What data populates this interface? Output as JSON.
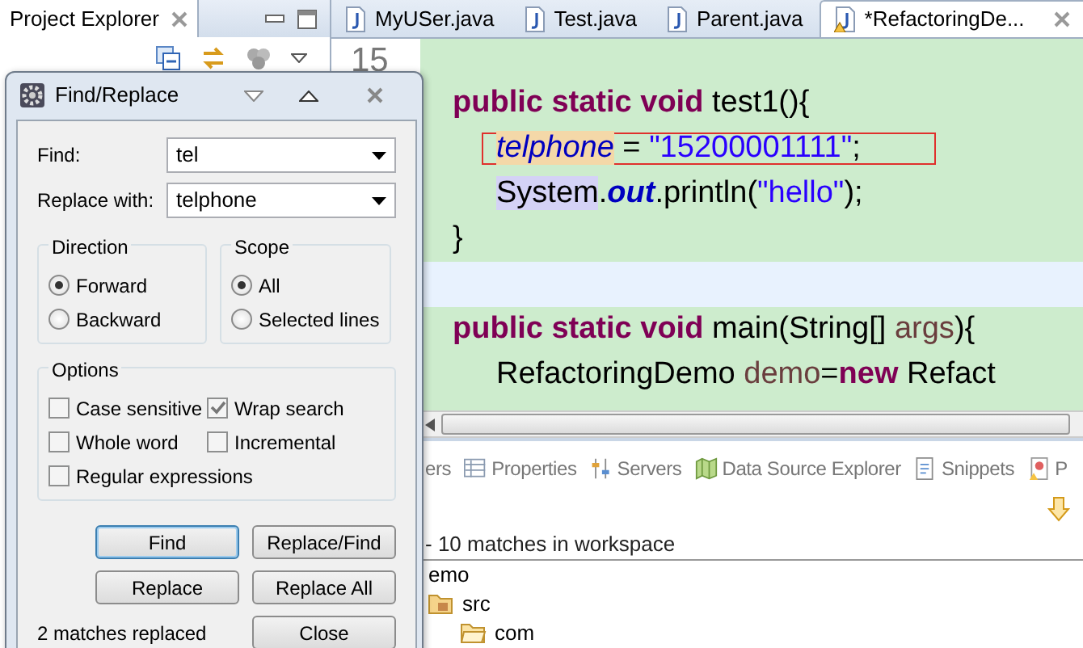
{
  "project_explorer": {
    "tab": "Project Explorer"
  },
  "editor_tabs": [
    {
      "label": "MyUSer.java",
      "selected": false,
      "warning": false
    },
    {
      "label": "Test.java",
      "selected": false,
      "warning": false
    },
    {
      "label": "Parent.java",
      "selected": false,
      "warning": false
    },
    {
      "label": "*RefactoringDe...",
      "selected": true,
      "warning": true
    }
  ],
  "editor": {
    "line_number": "15",
    "lines": [
      {
        "indented": false,
        "boxed": false,
        "current": false,
        "tokens": [
          {
            "text": "public static void",
            "kind": "keyword"
          },
          {
            "text": " test1(){",
            "kind": "plain"
          }
        ]
      },
      {
        "indented": true,
        "boxed": true,
        "current": false,
        "tokens": [
          {
            "text": "telphone",
            "kind": "field-match"
          },
          {
            "text": " = ",
            "kind": "plain"
          },
          {
            "text": "\"15200001111\"",
            "kind": "string"
          },
          {
            "text": ";",
            "kind": "plain"
          }
        ]
      },
      {
        "indented": true,
        "boxed": false,
        "current": false,
        "tokens": [
          {
            "text": "System",
            "kind": "type-occurrence"
          },
          {
            "text": ".",
            "kind": "plain"
          },
          {
            "text": "out",
            "kind": "static"
          },
          {
            "text": ".println(",
            "kind": "plain"
          },
          {
            "text": "\"hello\"",
            "kind": "string"
          },
          {
            "text": ");",
            "kind": "plain"
          }
        ]
      },
      {
        "indented": false,
        "boxed": false,
        "current": false,
        "tokens": [
          {
            "text": "}",
            "kind": "plain"
          }
        ]
      },
      {
        "indented": false,
        "boxed": false,
        "current": true
      },
      {
        "indented": false,
        "boxed": false,
        "current": false,
        "tokens": [
          {
            "text": "public static void",
            "kind": "keyword"
          },
          {
            "text": " main(String[] ",
            "kind": "plain"
          },
          {
            "text": "args",
            "kind": "local"
          },
          {
            "text": "){",
            "kind": "plain"
          }
        ]
      },
      {
        "indented": true,
        "boxed": false,
        "current": false,
        "tokens": [
          {
            "text": "RefactoringDemo ",
            "kind": "plain"
          },
          {
            "text": "demo",
            "kind": "local"
          },
          {
            "text": "=",
            "kind": "plain"
          },
          {
            "text": "new",
            "kind": "keyword"
          },
          {
            "text": " Refact",
            "kind": "plain"
          }
        ]
      }
    ]
  },
  "bottom_panel": {
    "tabs": [
      {
        "label": "ers",
        "kind": "none"
      },
      {
        "label": "Properties",
        "kind": "table"
      },
      {
        "label": "Servers",
        "kind": "sliders"
      },
      {
        "label": "Data Source Explorer",
        "kind": "map"
      },
      {
        "label": "Snippets",
        "kind": "document"
      },
      {
        "label": "P",
        "kind": "report"
      }
    ],
    "search_summary": "- 10 matches in workspace",
    "tree": [
      {
        "label": "emo",
        "children": [
          {
            "label": "src",
            "kind": "source-folder",
            "children": [
              {
                "label": "com",
                "kind": "folder"
              }
            ]
          }
        ]
      }
    ]
  },
  "find_replace": {
    "title": "Find/Replace",
    "find": {
      "label": "Find:",
      "value": "tel"
    },
    "replace": {
      "label": "Replace with:",
      "value": "telphone"
    },
    "direction": {
      "title": "Direction",
      "options": [
        {
          "label": "Forward",
          "selected": true
        },
        {
          "label": "Backward",
          "selected": false
        }
      ]
    },
    "scope": {
      "title": "Scope",
      "options": [
        {
          "label": "All",
          "selected": true
        },
        {
          "label": "Selected lines",
          "selected": false
        }
      ]
    },
    "options": {
      "title": "Options",
      "items": [
        {
          "label": "Case sensitive",
          "checked": false
        },
        {
          "label": "Wrap search",
          "checked": true
        },
        {
          "label": "Whole word",
          "checked": false
        },
        {
          "label": "Incremental",
          "checked": false
        },
        {
          "label": "Regular expressions",
          "checked": false
        }
      ]
    },
    "buttons": [
      {
        "label": "Find",
        "default": true
      },
      {
        "label": "Replace/Find",
        "default": false
      },
      {
        "label": "Replace",
        "default": false
      },
      {
        "label": "Replace All",
        "default": false
      },
      {
        "label": "Close",
        "default": false
      }
    ],
    "status": "2 matches replaced"
  }
}
